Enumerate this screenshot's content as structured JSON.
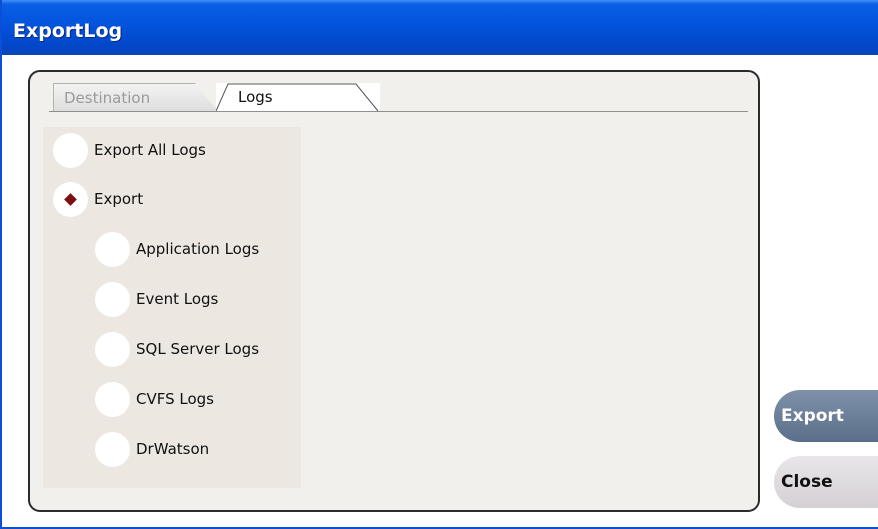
{
  "window": {
    "title": "ExportLog"
  },
  "tabs": [
    {
      "label": "Destination",
      "selected": false
    },
    {
      "label": "Logs",
      "selected": true
    }
  ],
  "options": {
    "export_all_logs": {
      "label": "Export All Logs",
      "selected": false
    },
    "export": {
      "label": "Export",
      "selected": true
    },
    "sub": [
      {
        "label": "Application Logs"
      },
      {
        "label": "Event Logs"
      },
      {
        "label": "SQL Server Logs"
      },
      {
        "label": "CVFS Logs"
      },
      {
        "label": "DrWatson"
      }
    ]
  },
  "buttons": {
    "export_label": "Export",
    "close_label": "Close"
  },
  "colors": {
    "titlebar": "#0353dc",
    "radio_dot": "#7a1010",
    "export_button": "#6b7f99",
    "close_button": "#e0dce0"
  }
}
